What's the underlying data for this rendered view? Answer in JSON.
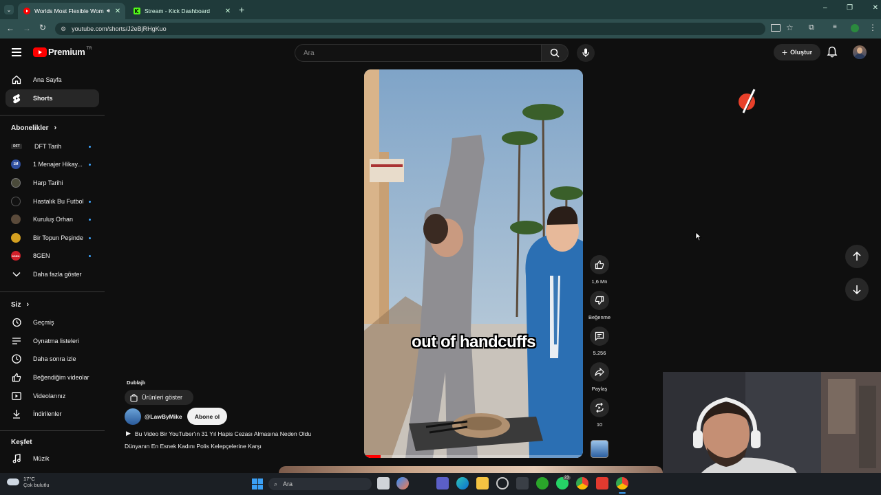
{
  "browser": {
    "tabs": [
      {
        "title": "Worlds Most Flexible Wom",
        "active": true
      },
      {
        "title": "Stream - Kick Dashboard",
        "active": false
      }
    ],
    "url": "youtube.com/shorts/J2eBjRHgKuo"
  },
  "header": {
    "logo_text": "Premium",
    "logo_sup": "TR",
    "search_placeholder": "Ara",
    "create_label": "Oluştur"
  },
  "sidebar": {
    "main": [
      {
        "label": "Ana Sayfa",
        "icon": "home-icon"
      },
      {
        "label": "Shorts",
        "icon": "shorts-icon",
        "active": true
      }
    ],
    "subscriptions_header": "Abonelikler",
    "subscriptions": [
      {
        "label": "DFT Tarih",
        "color": "#2a2a2a",
        "badge": "DFT"
      },
      {
        "label": "1 Menajer Hikay...",
        "color": "#2f4fa0",
        "badge": "1M"
      },
      {
        "label": "Harp Tarihi",
        "color": "#4a4a3a",
        "badge": ""
      },
      {
        "label": "Hastalık Bu Futbol",
        "color": "#111111",
        "badge": ""
      },
      {
        "label": "Kuruluş Orhan",
        "color": "#5a4a3a",
        "badge": ""
      },
      {
        "label": "Bir Topun Peşinde",
        "color": "#d4a020",
        "badge": ""
      },
      {
        "label": "8GEN",
        "color": "#d0202a",
        "badge": "8GEN"
      }
    ],
    "show_more": "Daha fazla göster",
    "you_header": "Siz",
    "you_items": [
      {
        "label": "Geçmiş",
        "icon": "history-icon"
      },
      {
        "label": "Oynatma listeleri",
        "icon": "playlist-icon"
      },
      {
        "label": "Daha sonra izle",
        "icon": "clock-icon"
      },
      {
        "label": "Beğendiğim videolar",
        "icon": "thumbs-up-icon"
      },
      {
        "label": "Videolarınız",
        "icon": "video-icon"
      },
      {
        "label": "İndirilenler",
        "icon": "download-icon"
      }
    ],
    "explore_header": "Keşfet",
    "explore_items": [
      {
        "label": "Müzik",
        "icon": "music-icon"
      }
    ]
  },
  "video": {
    "caption": "out of handcuffs",
    "dubbed_label": "Dublajlı",
    "products_label": "Ürünleri göster",
    "channel": "@LawByMike",
    "subscribe_label": "Abone ol",
    "title_line1": "Bu Video Bir YouTuber'ın 31 Yıl Hapis Cezası Almasına Neden Oldu",
    "title_line2": "Dünyanın En Esnek Kadını Polis Kelepçelerine Karşı"
  },
  "actions": {
    "likes": "1,6 Mn",
    "dislike_label": "Beğenme",
    "comments": "5.256",
    "share_label": "Paylaş",
    "remix_count": "10"
  },
  "taskbar": {
    "weather_temp": "17°C",
    "weather_desc": "Çok bulutlu",
    "search_label": "Ara",
    "whatsapp_badge": "23"
  },
  "colors": {
    "brand_red": "#ff0000",
    "accent_blue": "#3ea6ff",
    "chrome_teal": "#2f4f4f"
  }
}
